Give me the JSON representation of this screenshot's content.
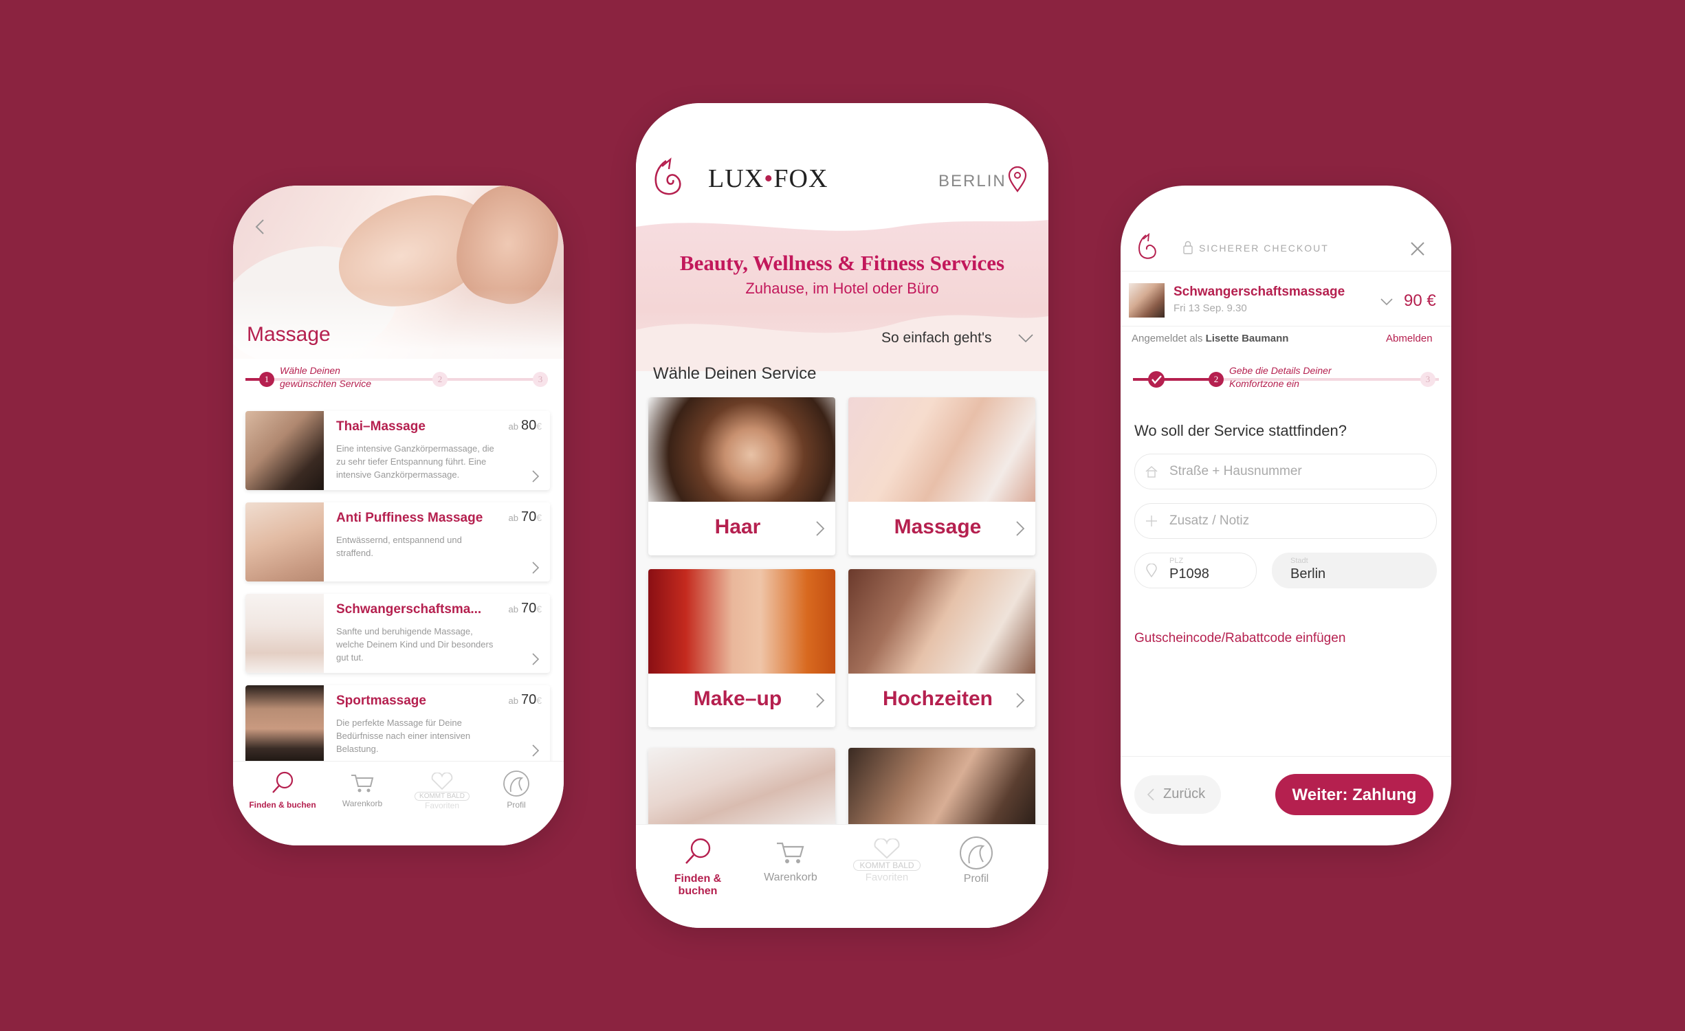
{
  "left_phone": {
    "title": "Massage",
    "steps": [
      {
        "num": "1",
        "label_line1": "Wähle Deinen",
        "label_line2": "gewünschten Service"
      },
      {
        "num": "2"
      },
      {
        "num": "3"
      }
    ],
    "services": [
      {
        "name": "Thai–Massage",
        "price_prefix": "ab",
        "price": "80",
        "currency": "€",
        "desc_1": "Eine intensive Ganzkörpermassage, die",
        "desc_2": "zu sehr tiefer Entspannung führt. Eine",
        "desc_3": "intensive Ganzkörpermassage."
      },
      {
        "name": "Anti Puffiness Massage",
        "price_prefix": "ab",
        "price": "70",
        "currency": "€",
        "desc_1": "Entwässernd, entspannend und",
        "desc_2": "straffend.",
        "desc_3": ""
      },
      {
        "name": "Schwangerschaftsma...",
        "price_prefix": "ab",
        "price": "70",
        "currency": "€",
        "desc_1": "Sanfte und beruhigende Massage,",
        "desc_2": "welche Deinem Kind und Dir besonders",
        "desc_3": "gut tut."
      },
      {
        "name": "Sportmassage",
        "price_prefix": "ab",
        "price": "70",
        "currency": "€",
        "desc_1": "Die perfekte Massage für Deine",
        "desc_2": "Bedürfnisse nach einer intensiven",
        "desc_3": "Belastung."
      }
    ],
    "tabs": {
      "find": "Finden & buchen",
      "cart": "Warenkorb",
      "soon": "KOMMT BALD",
      "fav": "Favoriten",
      "profile": "Profil"
    }
  },
  "middle_phone": {
    "brand_left": "LUX",
    "brand_dot": "•",
    "brand_right": "FOX",
    "city": "BERLIN",
    "headline": "Beauty, Wellness & Fitness Services",
    "subline": "Zuhause, im Hotel oder Büro",
    "how_it_works": "So einfach geht's",
    "choose_service": "Wähle Deinen Service",
    "categories": [
      "Haar",
      "Massage",
      "Make–up",
      "Hochzeiten"
    ],
    "tabs": {
      "find": "Finden & buchen",
      "cart": "Warenkorb",
      "soon": "KOMMT BALD",
      "fav": "Favoriten",
      "profile": "Profil"
    }
  },
  "right_phone": {
    "secure_checkout": "SICHERER CHECKOUT",
    "order_name": "Schwangerschaftsmassage",
    "order_date": "Fri 13 Sep. 9.30",
    "order_price": "90 €",
    "logged_in_prefix": "Angemeldet als",
    "user_name": "Lisette Baumann",
    "logout": "Abmelden",
    "step2_line1": "Gebe die Details Deiner",
    "step2_line2": "Komfortzone ein",
    "step2_num": "2",
    "step3_num": "3",
    "question": "Wo soll der Service stattfinden?",
    "street_placeholder": "Straße + Hausnummer",
    "note_placeholder": "Zusatz / Notiz",
    "plz_label": "PLZ",
    "plz_value": "P1098",
    "city_label": "Stadt",
    "city_value": "Berlin",
    "voucher": "Gutscheincode/Rabattcode einfügen",
    "back": "Zurück",
    "next": "Weiter: Zahlung"
  },
  "colors": {
    "background": "#8b2340",
    "accent": "#b5204f",
    "muted": "#9a9a9a"
  }
}
